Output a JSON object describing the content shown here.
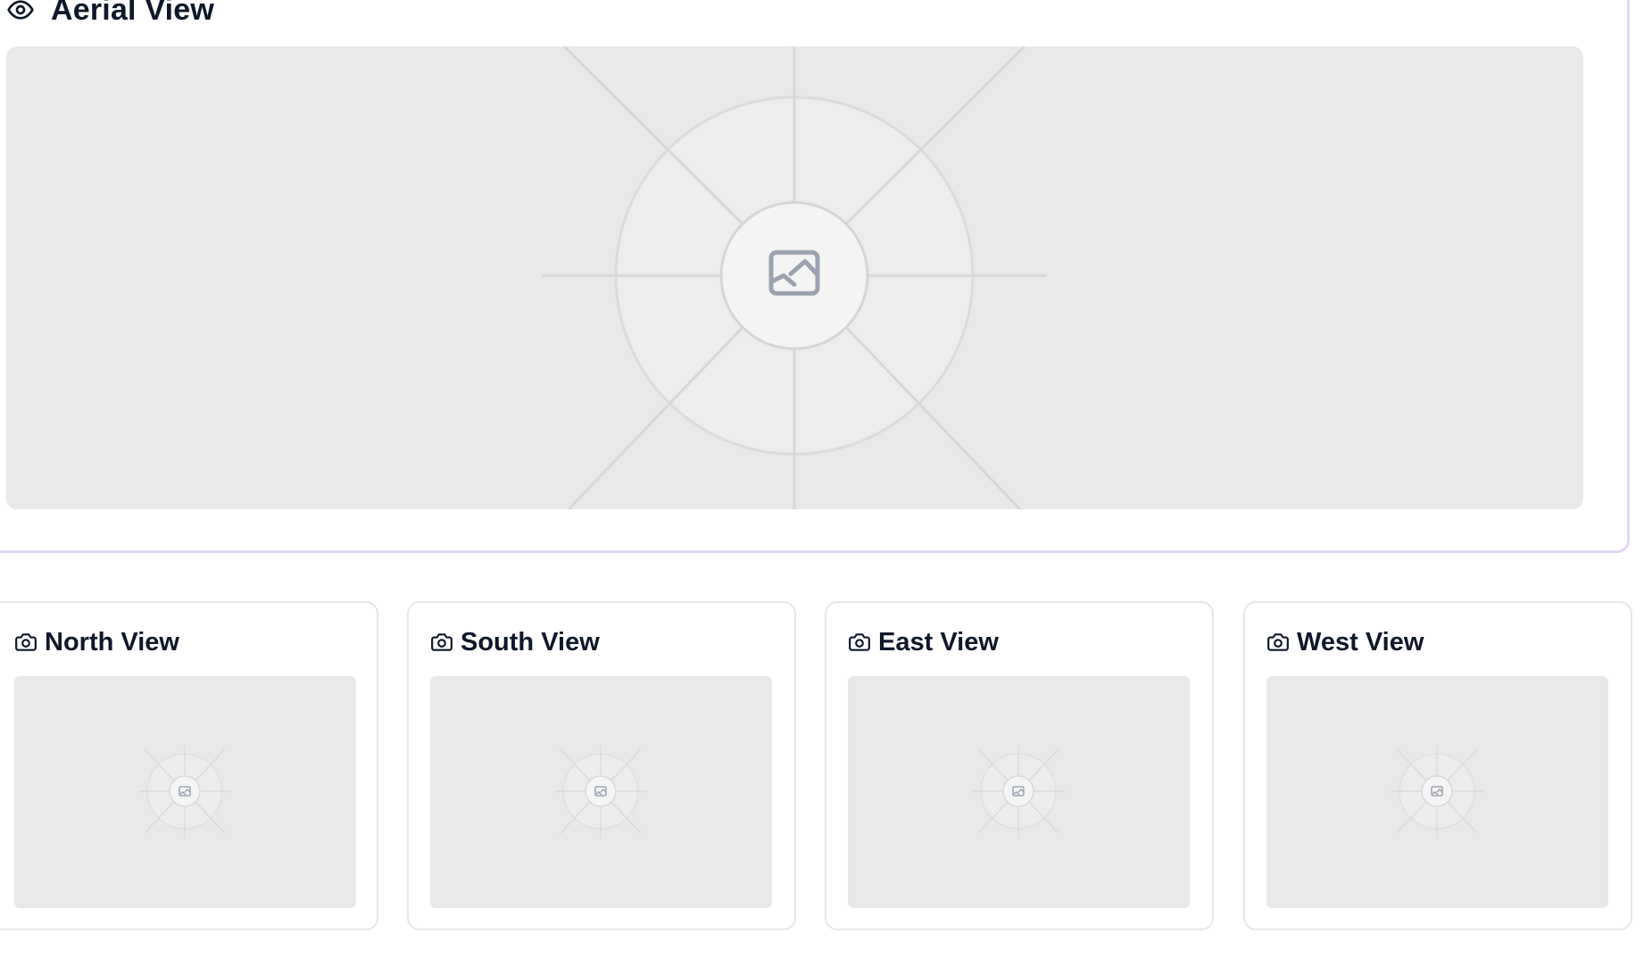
{
  "aerial": {
    "title": "Aerial View",
    "icon": "eye-icon",
    "image_icon": "image-placeholder-icon"
  },
  "views": [
    {
      "title": "North View",
      "icon": "camera-icon",
      "image_icon": "image-placeholder-icon"
    },
    {
      "title": "South View",
      "icon": "camera-icon",
      "image_icon": "image-placeholder-icon"
    },
    {
      "title": "East View",
      "icon": "camera-icon",
      "image_icon": "image-placeholder-icon"
    },
    {
      "title": "West View",
      "icon": "camera-icon",
      "image_icon": "image-placeholder-icon"
    }
  ],
  "colors": {
    "aerial_border": "#e3d6f5",
    "card_border": "#e5e7eb",
    "image_bg": "#e9e9e9",
    "placeholder_icon": "#9ca3af"
  }
}
